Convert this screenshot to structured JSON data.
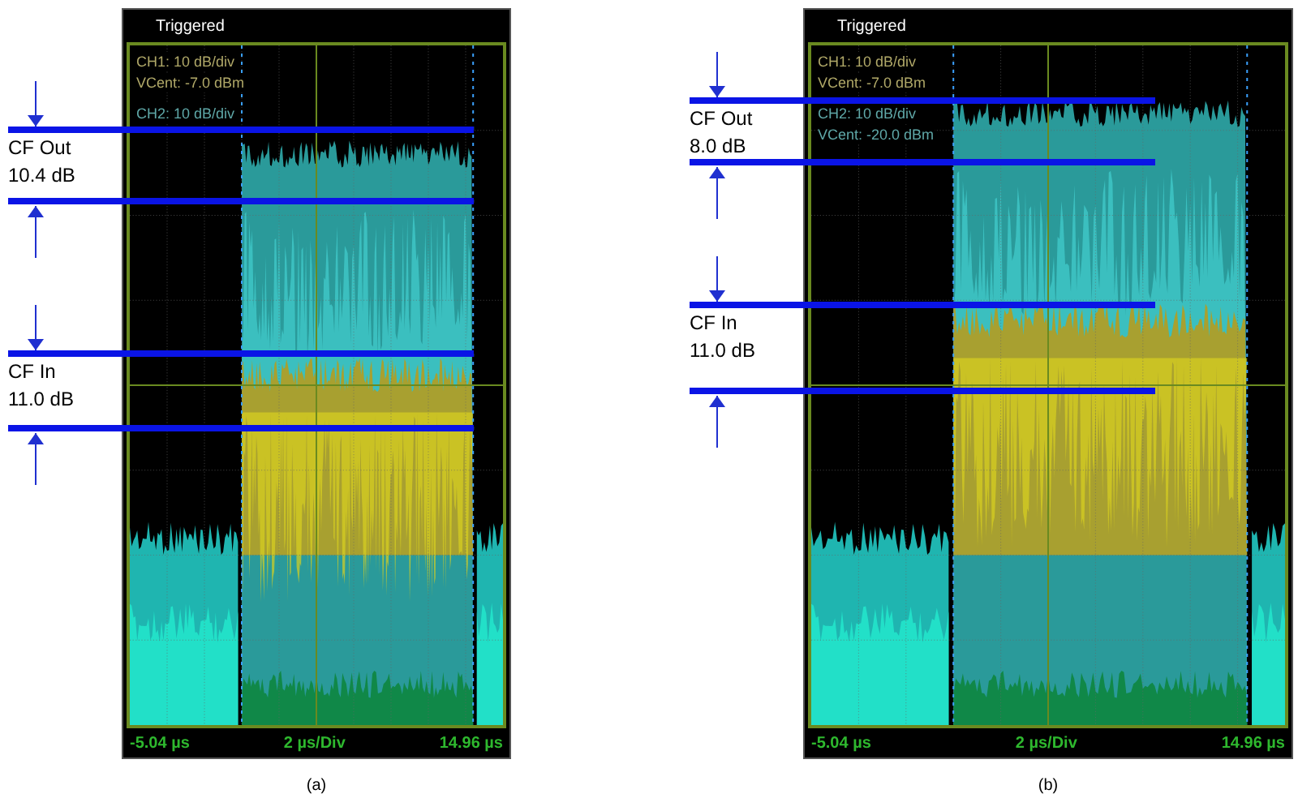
{
  "panels": [
    {
      "caption": "(a)",
      "status": "Triggered",
      "traces": [
        {
          "text": "CH1: 10 dB/div",
          "color": "#b0a868"
        },
        {
          "text": "VCent: -7.0 dBm",
          "color": "#b0a868"
        },
        {
          "text": "CH2: 10 dB/div",
          "color": "#5fa8a8"
        }
      ],
      "x_start": "-5.04 µs",
      "x_scale": "2 µs/Div",
      "x_end": "14.96 µs",
      "measurements": [
        {
          "label": "CF Out",
          "value": "10.4 dB"
        },
        {
          "label": "CF In",
          "value": "11.0 dB"
        }
      ]
    },
    {
      "caption": "(b)",
      "status": "Triggered",
      "traces": [
        {
          "text": "CH1: 10 dB/div",
          "color": "#b0a868"
        },
        {
          "text": "VCent: -7.0 dBm",
          "color": "#b0a868"
        },
        {
          "text": "CH2: 10 dB/div",
          "color": "#5fa8a8"
        },
        {
          "text": "VCent: -20.0 dBm",
          "color": "#5fa8a8"
        }
      ],
      "x_start": "-5.04 µs",
      "x_scale": "2 µs/Div",
      "x_end": "14.96 µs",
      "measurements": [
        {
          "label": "CF Out",
          "value": "8.0 dB"
        },
        {
          "label": "CF In",
          "value": "11.0 dB"
        }
      ]
    }
  ]
}
